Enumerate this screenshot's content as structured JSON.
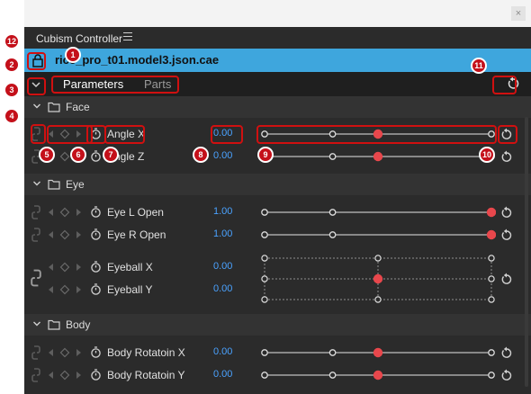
{
  "window": {
    "title": "Cubism Controller",
    "close_glyph": "×"
  },
  "model": {
    "filename": "rice_pro_t01.model3.json.cae"
  },
  "tabs": [
    {
      "label": "Parameters",
      "active": true
    },
    {
      "label": "Parts",
      "active": false
    }
  ],
  "groups": [
    {
      "name": "Face",
      "params": [
        {
          "name": "Angle X",
          "value": "0.00",
          "position": 0.5
        },
        {
          "name": "Angle Z",
          "value": "0.00",
          "position": 0.5
        }
      ]
    },
    {
      "name": "Eye",
      "params": [
        {
          "name": "Eye L Open",
          "value": "1.00",
          "position": 1.0
        },
        {
          "name": "Eye R Open",
          "value": "1.00",
          "position": 1.0
        },
        {
          "name": "Eyeball X",
          "value": "0.00",
          "position": 0.5
        },
        {
          "name": "Eyeball Y",
          "value": "0.00",
          "position": 0.5
        }
      ]
    },
    {
      "name": "Body",
      "params": [
        {
          "name": "Body Rotatoin X",
          "value": "0.00",
          "position": 0.5
        },
        {
          "name": "Body Rotatoin Y",
          "value": "0.00",
          "position": 0.5
        }
      ]
    }
  ],
  "annotations": [
    "1",
    "2",
    "3",
    "4",
    "5",
    "6",
    "7",
    "8",
    "9",
    "10",
    "11",
    "12"
  ],
  "colors": {
    "accent_blue": "#3ea6dd",
    "value_blue": "#4aa2ff",
    "slider_handle": "#e8474c",
    "annotation_red": "#c4101a"
  }
}
